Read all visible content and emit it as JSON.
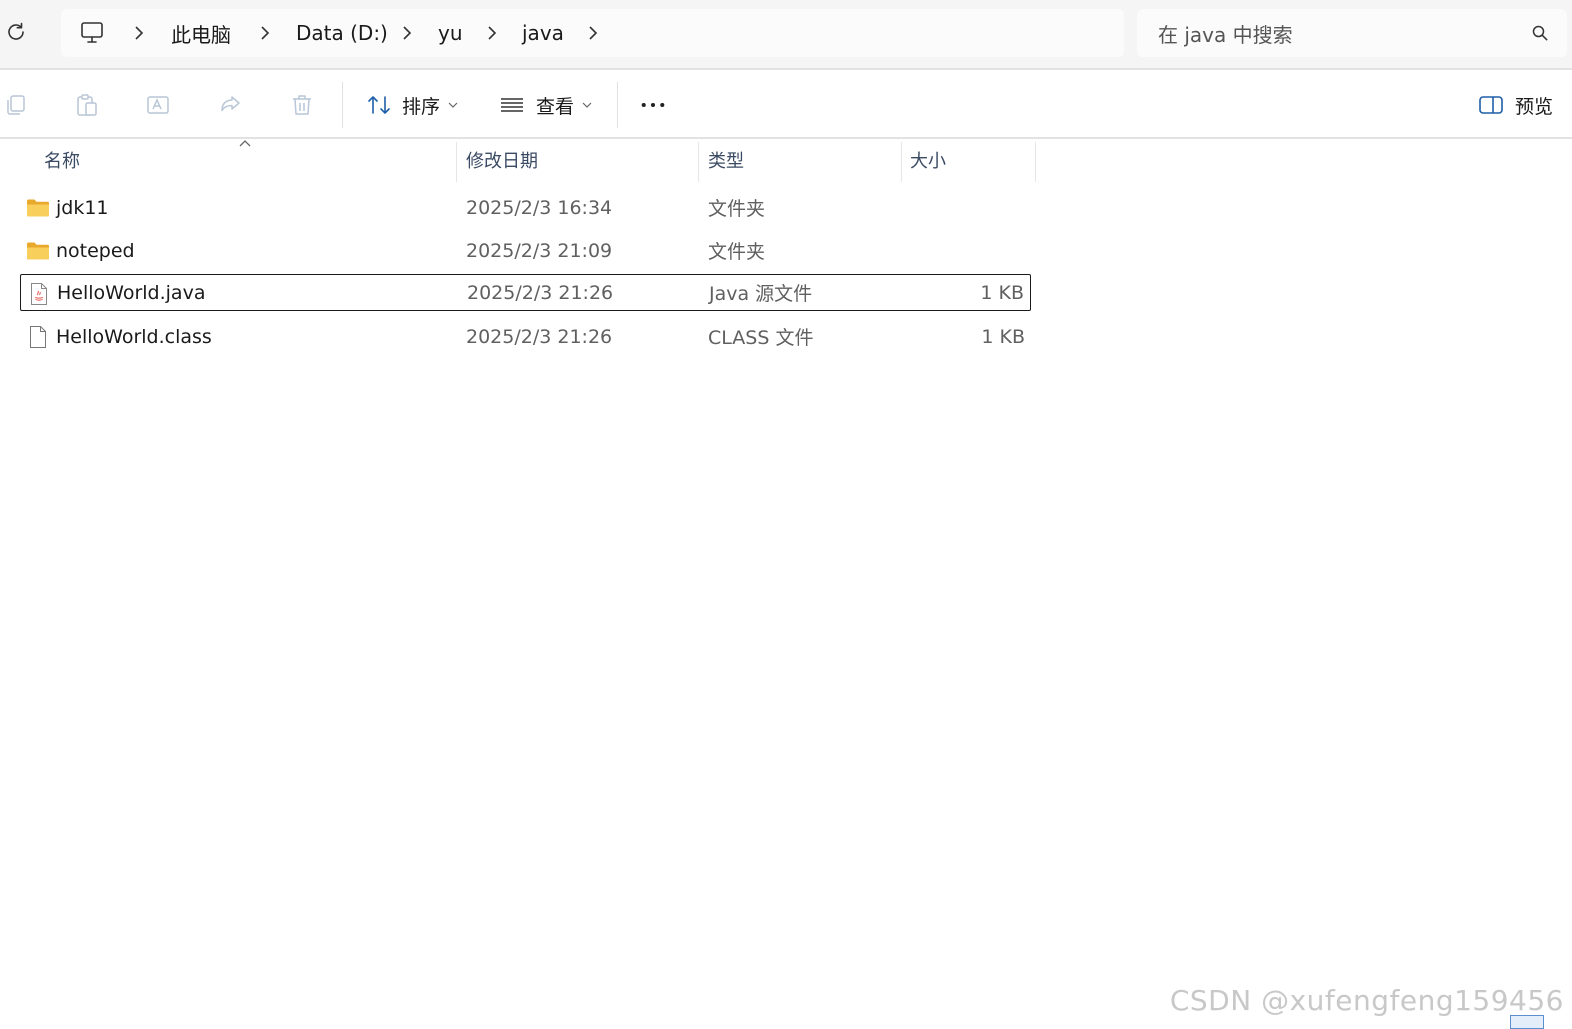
{
  "address_bar": {
    "refresh_icon": "refresh-icon",
    "breadcrumb": [
      {
        "label": "此电脑"
      },
      {
        "label": "Data (D:)"
      },
      {
        "label": "yu"
      },
      {
        "label": "java"
      }
    ],
    "pc_icon": "monitor-icon",
    "search_placeholder": "在 java 中搜索"
  },
  "command_bar": {
    "icons": [
      "copy-icon",
      "paste-icon",
      "rename-icon",
      "share-icon",
      "delete-icon"
    ],
    "sort_label": "排序",
    "view_label": "查看",
    "more_icon": "more-icon",
    "preview_label": "预览"
  },
  "columns": {
    "name": "名称",
    "date": "修改日期",
    "type": "类型",
    "size": "大小"
  },
  "files": [
    {
      "name": "jdk11",
      "date": "2025/2/3 16:34",
      "type": "文件夹",
      "size": "",
      "icon": "folder-icon"
    },
    {
      "name": "noteped",
      "date": "2025/2/3 21:09",
      "type": "文件夹",
      "size": "",
      "icon": "folder-icon"
    },
    {
      "name": "HelloWorld.java",
      "date": "2025/2/3 21:26",
      "type": "Java 源文件",
      "size": "1 KB",
      "icon": "java-file-icon",
      "selected": true
    },
    {
      "name": "HelloWorld.class",
      "date": "2025/2/3 21:26",
      "type": "CLASS 文件",
      "size": "1 KB",
      "icon": "file-icon"
    }
  ],
  "watermark": "CSDN @xufengfeng159456",
  "colors": {
    "folder": "#f5c542",
    "accent": "#0067c0",
    "header_text": "#3b4a63"
  }
}
